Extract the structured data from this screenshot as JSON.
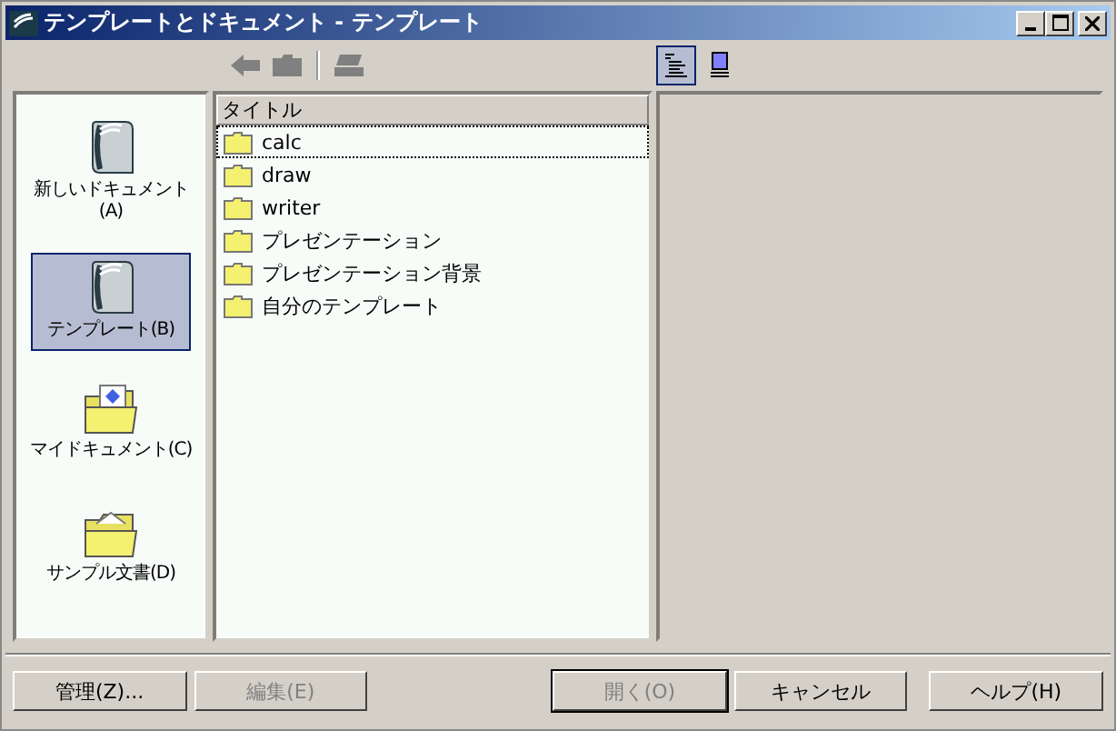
{
  "window": {
    "title": "テンプレートとドキュメント - テンプレート"
  },
  "toolbar": [
    {
      "kind": "back",
      "disabled": true
    },
    {
      "kind": "folder",
      "disabled": true
    },
    {
      "kind": "separator"
    },
    {
      "kind": "print",
      "disabled": true
    }
  ],
  "view_buttons": [
    {
      "kind": "list",
      "selected": true
    },
    {
      "kind": "preview",
      "selected": false
    }
  ],
  "sidebar": {
    "items": [
      {
        "label": "新しいドキュメント(A)",
        "kind": "document",
        "selected": false
      },
      {
        "label": "テンプレート(B)",
        "kind": "document",
        "selected": true
      },
      {
        "label": "マイドキュメント(C)",
        "kind": "folder-doc",
        "selected": false
      },
      {
        "label": "サンプル文書(D)",
        "kind": "folder",
        "selected": false
      }
    ]
  },
  "list": {
    "column": "タイトル",
    "items": [
      {
        "label": "calc",
        "selected": true
      },
      {
        "label": "draw",
        "selected": false
      },
      {
        "label": "writer",
        "selected": false
      },
      {
        "label": "プレゼンテーション",
        "selected": false
      },
      {
        "label": "プレゼンテーション背景",
        "selected": false
      },
      {
        "label": "自分のテンプレート",
        "selected": false
      }
    ]
  },
  "buttons": [
    {
      "label": "管理(Z)...",
      "disabled": false,
      "default": false
    },
    {
      "label": "編集(E)",
      "disabled": true,
      "default": false
    },
    {
      "label": "開く(O)",
      "disabled": true,
      "default": true
    },
    {
      "label": "キャンセル",
      "disabled": false,
      "default": false
    },
    {
      "label": "ヘルプ(H)",
      "disabled": false,
      "default": false
    }
  ]
}
